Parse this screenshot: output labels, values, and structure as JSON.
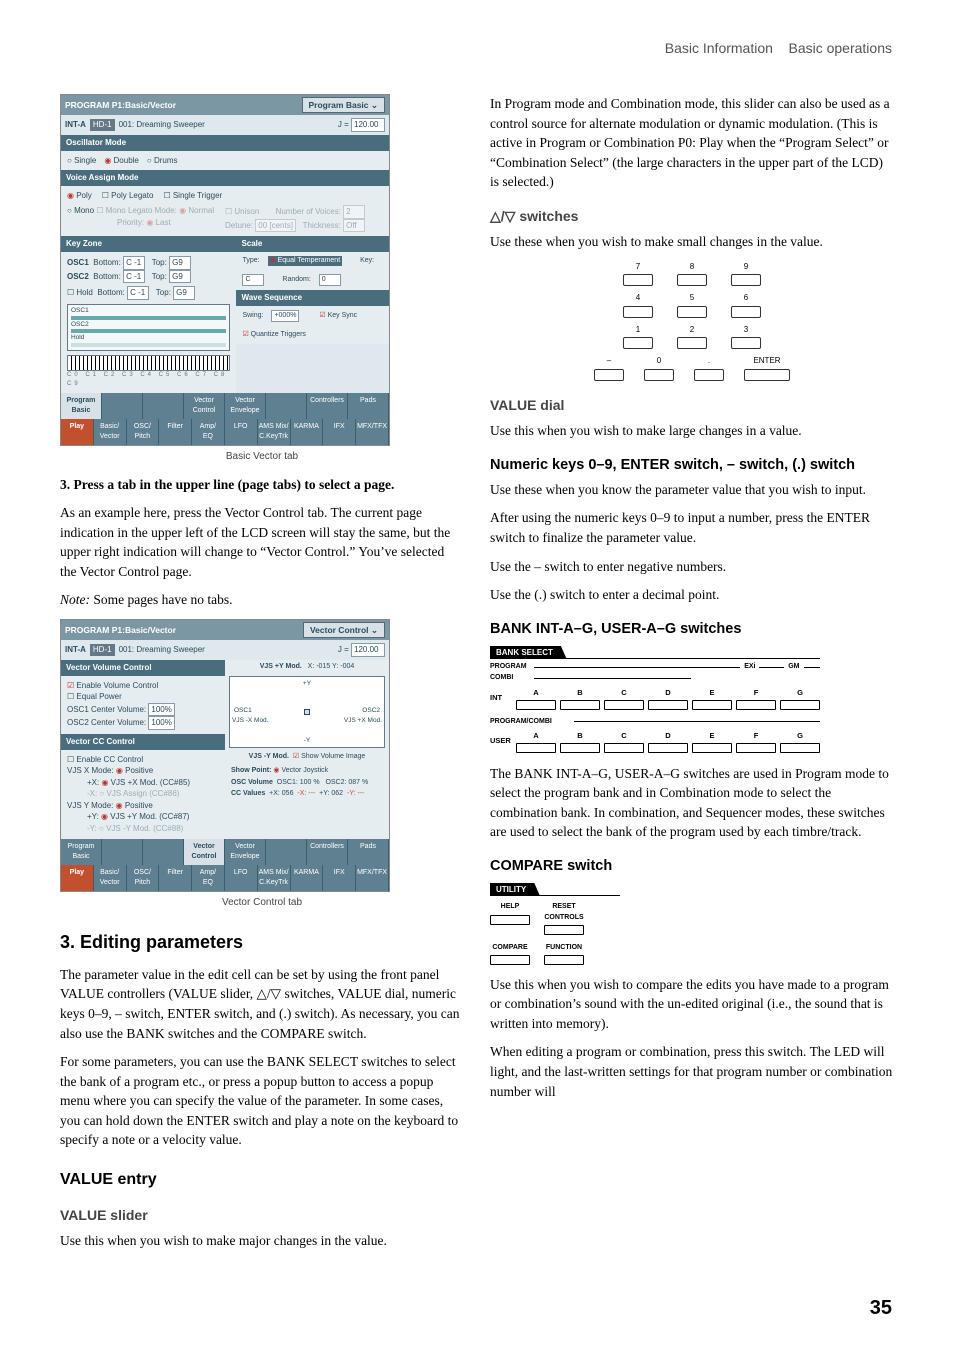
{
  "header": {
    "left": "Basic Information",
    "right": "Basic operations"
  },
  "page_number": "35",
  "captions": {
    "fig1": "Basic Vector tab",
    "fig2": "Vector Control tab"
  },
  "left": {
    "step3": "3. Press a tab in the upper line (page tabs) to select a page.",
    "p1": "As an example here, press the Vector Control tab. The current page indication in the upper left of the LCD screen will stay the same, but the upper right indication will change to “Vector Control.” You’ve selected the Vector Control page.",
    "note_label": "Note:",
    "note_text": " Some pages have no tabs.",
    "h_editing": "3. Editing parameters",
    "p_edit1": "The parameter value in the edit cell can be set by using the front panel VALUE controllers (VALUE slider, △/▽ switches, VALUE dial, numeric keys 0–9, – switch, ENTER switch, and (.) switch). As necessary, you can also use the BANK switches and the COMPARE switch.",
    "p_edit2": "For some parameters, you can use the BANK SELECT switches to select the bank of a program etc., or press a popup button to access a popup menu where you can specify the value of the parameter. In some cases, you can hold down the ENTER switch and play a note on the keyboard to specify a note or a velocity value.",
    "h_value_entry": "VALUE entry",
    "h_value_slider": "VALUE slider",
    "p_value_slider": "Use this when you wish to make major changes in the value."
  },
  "right": {
    "p_top": "In Program mode and Combination mode, this slider can also be used as a control source for alternate modulation or dynamic modulation. (This is active in Program or Combination P0: Play when the “Program Select” or “Combination Select” (the large characters in the upper part of the LCD) is selected.)",
    "h_switches": "△/▽ switches",
    "p_switches": "Use these when you wish to make small changes in the value.",
    "h_dial": "VALUE dial",
    "p_dial": "Use this when you wish to make large changes in a value.",
    "h_numeric": "Numeric keys 0–9, ENTER switch, – switch, (.) switch",
    "p_num1": "Use these when you know the parameter value that you wish to input.",
    "p_num2": "After using the numeric keys 0–9 to input a number, press the ENTER switch to finalize the parameter value.",
    "p_num3": "Use the – switch to enter negative numbers.",
    "p_num4": "Use the (.) switch to enter a decimal point.",
    "h_bank": "BANK INT-A–G, USER-A–G switches",
    "p_bank": "The BANK INT-A–G, USER-A–G switches are used in Program mode to select the program bank and in Combination mode to select the combination bank. In combination, and Sequencer modes, these switches are used to select the bank of the program used by each timbre/track.",
    "h_compare": "COMPARE switch",
    "p_comp1": "Use this when you wish to compare the edits you have made to a program or combination’s sound with the un-edited original (i.e., the sound that is written into memory).",
    "p_comp2": "When editing a program or combination, press this switch. The LED will light, and the last-written settings for that program number or combination number will"
  },
  "lcd1": {
    "title_left": "PROGRAM P1:Basic/Vector",
    "title_right": "Program Basic",
    "bank": "INT-A",
    "bank_tag": "HD-1",
    "prog": "001: Dreaming Sweeper",
    "tempo_label": "J =",
    "tempo": "120.00",
    "osc_mode_head": "Oscillator Mode",
    "osc_single": "Single",
    "osc_double": "Double",
    "osc_drums": "Drums",
    "voice_head": "Voice Assign Mode",
    "poly": "Poly",
    "poly_legato": "Poly Legato",
    "single_trig": "Single Trigger",
    "mono": "Mono",
    "mono_legato": "Mono Legato",
    "mode_label": "Mode:",
    "mode_normal": "Normal",
    "unison": "Unison",
    "num_voices": "Number of Voices:",
    "nv_val": "2",
    "prio_label": "Priority:",
    "prio_last": "Last",
    "detune": "Detune:",
    "detune_val": "00 [cents]",
    "thick": "Thickness:",
    "thick_val": "Off",
    "kz_head": "Key Zone",
    "osc1": "OSC1",
    "osc2": "OSC2",
    "bottom": "Bottom:",
    "top": "Top:",
    "bot_val": "C -1",
    "top_val": "G9",
    "hold": "Hold",
    "scale_head": "Scale",
    "scale_type": "Type:",
    "scale_val": "Equal Temperament",
    "scale_key": "Key:",
    "scale_key_v": "C",
    "scale_rand": "Random:",
    "scale_rand_v": "0",
    "ws_head": "Wave Sequence",
    "swing": "Swing:",
    "swing_v": "+000%",
    "key_sync": "Key Sync",
    "qtrig": "Quantize Triggers",
    "kbd_ticks": "C0  C1  C2  C3  C4  C5  C6  C7  C8  C9",
    "upper_tabs": [
      "Program Basic",
      "",
      "",
      "Vector Control",
      "Vector Envelope",
      "",
      "Controllers",
      "Pads"
    ],
    "lower_tabs": [
      "Play",
      "Basic/\nVector",
      "OSC/\nPitch",
      "Filter",
      "Amp/\nEQ",
      "LFO",
      "AMS Mix/\nC.KeyTrk",
      "KARMA",
      "IFX",
      "MFX/TFX"
    ]
  },
  "lcd2": {
    "title_left": "PROGRAM P1:Basic/Vector",
    "title_right": "Vector Control",
    "bank": "INT-A",
    "bank_tag": "HD-1",
    "prog": "001: Dreaming Sweeper",
    "tempo_label": "J =",
    "tempo": "120.00",
    "vvc_head": "Vector Volume Control",
    "enable_vol": "Enable Volume Control",
    "equal_power": "Equal Power",
    "osc1cv": "OSC1 Center Volume:",
    "osc2cv": "OSC2 Center Volume:",
    "cv_val": "100%",
    "vcc_head": "Vector CC Control",
    "enable_cc": "Enable CC Control",
    "vjsx": "VJS X Mode:",
    "posi": "Positive",
    "vjsy": "VJS Y Mode:",
    "px": "+X:",
    "mx": "-X:",
    "py": "+Y:",
    "my": "-Y:",
    "pxv": "VJS +X Mod.",
    "mxv": "VJS Assign",
    "pyv": "VJS +Y Mod.",
    "myv": "VJS -Y Mod.",
    "cc85": "(CC#85)",
    "cc86": "(CC#86)",
    "cc87": "(CC#87)",
    "cc88": "(CC#88)",
    "ymod": "VJS +Y Mod.",
    "xy": "X: -015  Y: -004",
    "ymodn": "-Y",
    "xmodp": "+X",
    "o1": "OSC1",
    "o2": "OSC2",
    "xlab": "VJS -X Mod.",
    "xlabp": "VJS +X Mod.",
    "svi": "Show Volume Image",
    "show_point": "Show Point:",
    "sp_val": "Vector Joystick",
    "osc_vol": "OSC Volume",
    "osc1v": "OSC1: 100 %",
    "osc2v": "OSC2: 087 %",
    "cc_vals": "CC Values",
    "pxvv": "+X: 056",
    "mxvv": "-X: ---",
    "pyvv": "+Y: 062",
    "myvv": "-Y: ---",
    "upper_tabs": [
      "Program Basic",
      "",
      "",
      "Vector Control",
      "Vector Envelope",
      "",
      "Controllers",
      "Pads"
    ],
    "lower_tabs": [
      "Play",
      "Basic/\nVector",
      "OSC/\nPitch",
      "Filter",
      "Amp/\nEQ",
      "LFO",
      "AMS Mix/\nC.KeyTrk",
      "KARMA",
      "IFX",
      "MFX/TFX"
    ]
  },
  "keypad": {
    "row1": [
      "7",
      "8",
      "9"
    ],
    "row2": [
      "4",
      "5",
      "6"
    ],
    "row3": [
      "1",
      "2",
      "3"
    ],
    "row4": [
      "–",
      "0",
      "."
    ],
    "enter": "ENTER"
  },
  "bank": {
    "title": "BANK SELECT",
    "line1_left": "PROGRAM",
    "exi": "EXi",
    "gm": "GM",
    "line2_left": "COMBI",
    "int": "INT",
    "user": "USER",
    "letters": [
      "A",
      "B",
      "C",
      "D",
      "E",
      "F",
      "G"
    ],
    "pc": "PROGRAM/COMBI"
  },
  "util": {
    "title": "UTILITY",
    "help": "HELP",
    "reset": "RESET\nCONTROLS",
    "compare": "COMPARE",
    "function": "FUNCTION"
  }
}
